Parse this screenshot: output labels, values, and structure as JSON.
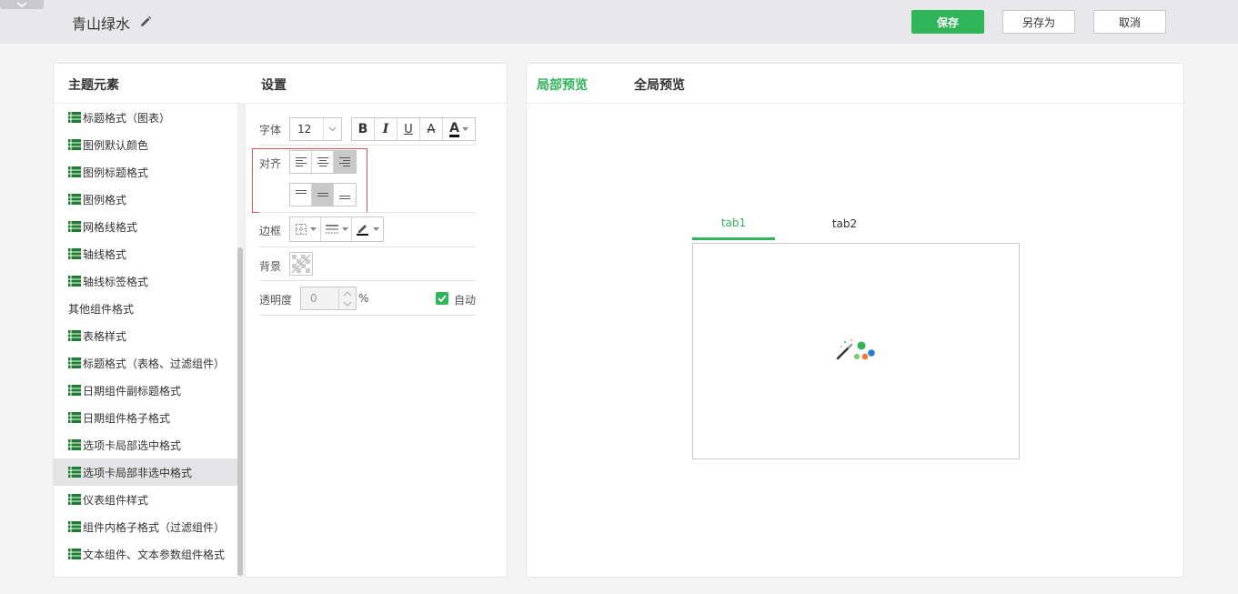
{
  "header": {
    "title": "青山绿水",
    "save_label": "保存",
    "save_as_label": "另存为",
    "cancel_label": "取消"
  },
  "left_panel": {
    "elements_heading": "主题元素",
    "settings_heading": "设置",
    "items": [
      {
        "label": "标题格式（图表）",
        "icon": true
      },
      {
        "label": "图例默认颜色",
        "icon": true
      },
      {
        "label": "图例标题格式",
        "icon": true
      },
      {
        "label": "图例格式",
        "icon": true
      },
      {
        "label": "网格线格式",
        "icon": true
      },
      {
        "label": "轴线格式",
        "icon": true
      },
      {
        "label": "轴线标签格式",
        "icon": true
      },
      {
        "label": "其他组件格式",
        "icon": false
      },
      {
        "label": "表格样式",
        "icon": true
      },
      {
        "label": "标题格式（表格、过滤组件）",
        "icon": true
      },
      {
        "label": "日期组件副标题格式",
        "icon": true
      },
      {
        "label": "日期组件格子格式",
        "icon": true
      },
      {
        "label": "选项卡局部选中格式",
        "icon": true
      },
      {
        "label": "选项卡局部非选中格式",
        "icon": true,
        "selected": true
      },
      {
        "label": "仪表组件样式",
        "icon": true
      },
      {
        "label": "组件内格子格式（过滤组件）",
        "icon": true
      },
      {
        "label": "文本组件、文本参数组件格式",
        "icon": true
      }
    ]
  },
  "settings": {
    "font_label": "字体",
    "font_size": "12",
    "bold_label": "B",
    "italic_label": "I",
    "underline_label": "U",
    "strike_label": "A",
    "color_label": "A",
    "align_label": "对齐",
    "border_label": "边框",
    "background_label": "背景",
    "opacity_label": "透明度",
    "opacity_value": "0",
    "opacity_unit": "%",
    "auto_label": "自动"
  },
  "right_panel": {
    "tab_local": "局部预览",
    "tab_global": "全局预览",
    "preview_tabs": [
      "tab1",
      "tab2"
    ]
  },
  "colors": {
    "accent": "#2fb55a",
    "highlight_border": "#d9534f"
  }
}
